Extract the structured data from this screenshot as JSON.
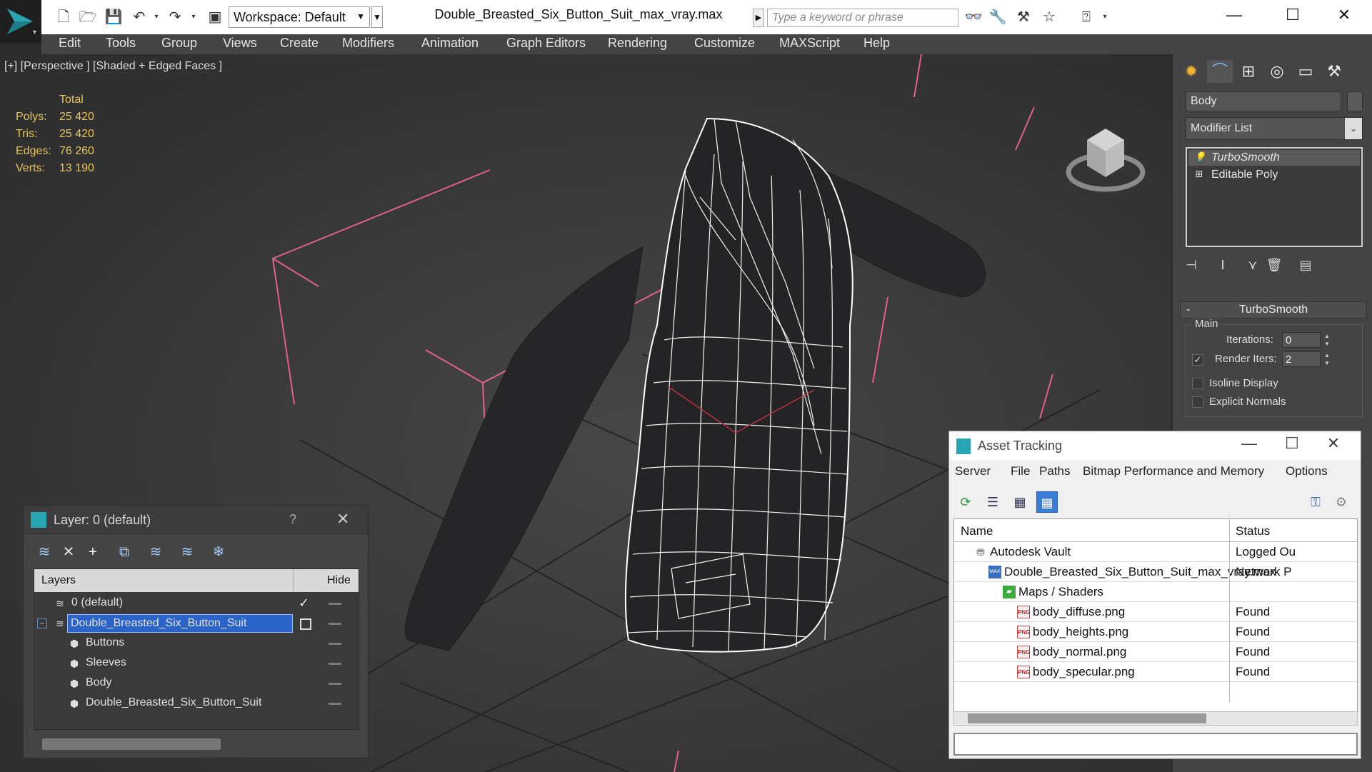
{
  "titlebar": {
    "workspace_label": "Workspace: Default",
    "doc_title": "Double_Breasted_Six_Button_Suit_max_vray.max",
    "search_placeholder": "Type a keyword or phrase"
  },
  "menus": [
    "Edit",
    "Tools",
    "Group",
    "Views",
    "Create",
    "Modifiers",
    "Animation",
    "Graph Editors",
    "Rendering",
    "Customize",
    "MAXScript",
    "Help"
  ],
  "viewport": {
    "label": "[+] [Perspective ] [Shaded + Edged Faces ]",
    "stats_header": "Total",
    "stats": [
      {
        "label": "Polys:",
        "value": "25 420"
      },
      {
        "label": "Tris:",
        "value": "25 420"
      },
      {
        "label": "Edges:",
        "value": "76 260"
      },
      {
        "label": "Verts:",
        "value": "13 190"
      }
    ]
  },
  "command_panel": {
    "object_name": "Body",
    "modifier_list": "Modifier List",
    "stack": [
      {
        "label": "TurboSmooth",
        "selected": true
      },
      {
        "label": "Editable Poly",
        "selected": false
      }
    ],
    "rollout_title": "TurboSmooth",
    "group_label": "Main",
    "iterations_label": "Iterations:",
    "iterations_value": "0",
    "render_iters_label": "Render Iters:",
    "render_iters_value": "2",
    "render_iters_checked": true,
    "isoline_label": "Isoline Display",
    "explicit_normals_label": "Explicit Normals"
  },
  "layer_dialog": {
    "title": "Layer: 0 (default)",
    "help": "?",
    "col_layers": "Layers",
    "col_hide": "Hide",
    "rows": [
      {
        "name": "0 (default)",
        "level": 0,
        "current": true
      },
      {
        "name": "Double_Breasted_Six_Button_Suit",
        "level": 0,
        "selected": true
      },
      {
        "name": "Buttons",
        "level": 1
      },
      {
        "name": "Sleeves",
        "level": 1
      },
      {
        "name": "Body",
        "level": 1
      },
      {
        "name": "Double_Breasted_Six_Button_Suit",
        "level": 1
      }
    ]
  },
  "asset_dialog": {
    "title": "Asset Tracking",
    "menus": [
      "Server",
      "File",
      "Paths",
      "Bitmap Performance and Memory",
      "Options"
    ],
    "col_name": "Name",
    "col_status": "Status",
    "rows": [
      {
        "name": "Autodesk Vault",
        "status": "Logged Ou",
        "level": 1,
        "icon": "vault-icon"
      },
      {
        "name": "Double_Breasted_Six_Button_Suit_max_vray.max",
        "status": "Network P",
        "level": 2,
        "icon": "max-file-icon"
      },
      {
        "name": "Maps / Shaders",
        "status": "",
        "level": 3,
        "icon": "maps-icon"
      },
      {
        "name": "body_diffuse.png",
        "status": "Found",
        "level": 4,
        "icon": "png-icon"
      },
      {
        "name": "body_heights.png",
        "status": "Found",
        "level": 4,
        "icon": "png-icon"
      },
      {
        "name": "body_normal.png",
        "status": "Found",
        "level": 4,
        "icon": "png-icon"
      },
      {
        "name": "body_specular.png",
        "status": "Found",
        "level": 4,
        "icon": "png-icon"
      }
    ]
  },
  "colors": {
    "accent_blue": "#2a64c8",
    "stats_yellow": "#e6c55a",
    "gizmo_pink": "#e06090",
    "panel_gray": "#444444"
  }
}
